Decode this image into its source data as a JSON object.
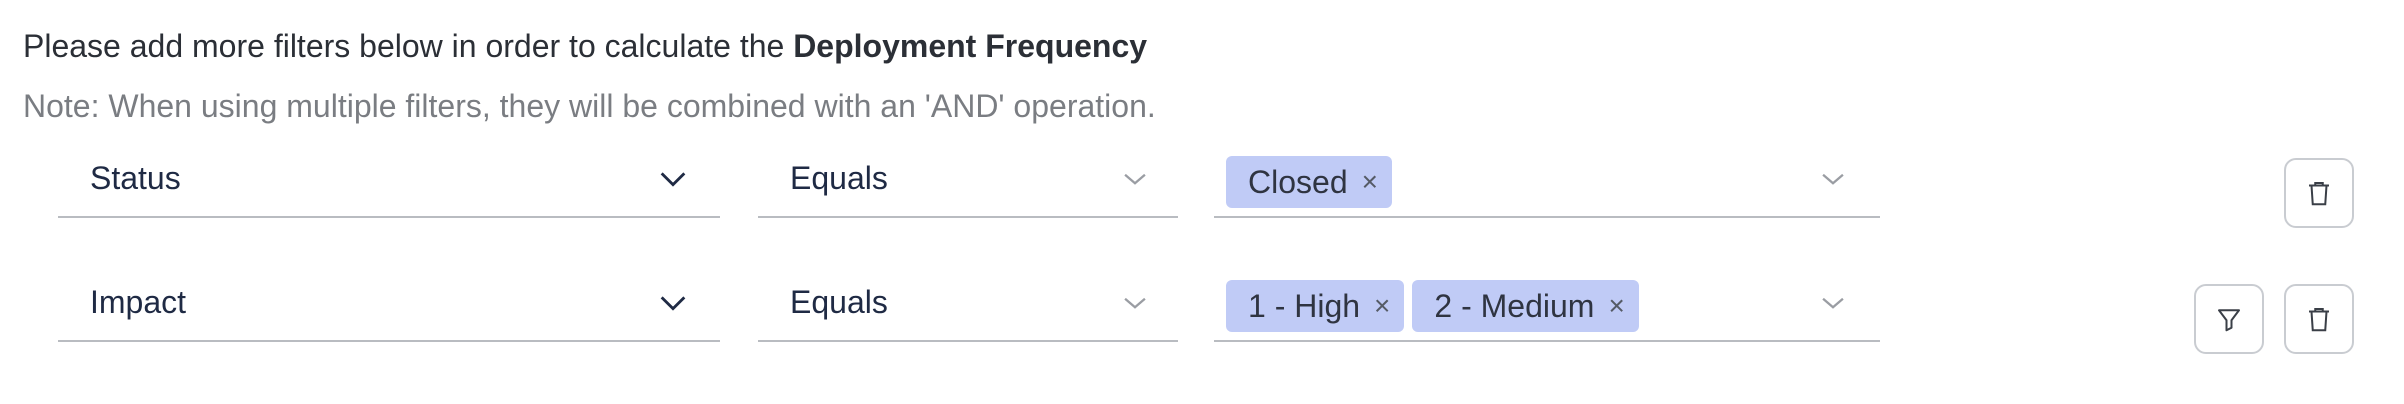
{
  "intro": {
    "text_prefix": "Please add more filters below in order to calculate the ",
    "metric_name": "Deployment Frequency"
  },
  "note": "Note: When using multiple filters, they will be combined with an 'AND' operation.",
  "filters": [
    {
      "field": "Status",
      "operator": "Equals",
      "values": [
        "Closed"
      ],
      "actions": [
        "delete"
      ]
    },
    {
      "field": "Impact",
      "operator": "Equals",
      "values": [
        "1 - High",
        "2 - Medium"
      ],
      "actions": [
        "filter",
        "delete"
      ]
    }
  ],
  "icons": {
    "remove_tag": "close-icon",
    "dropdown": "chevron-down-icon",
    "filter": "funnel-icon",
    "delete": "trash-icon"
  },
  "colors": {
    "tag_background": "#c0cbf6",
    "text_primary": "#2b2f36",
    "text_muted": "#7a7d82",
    "underline": "#b9bcc1"
  },
  "glyphs": {
    "close": "×"
  }
}
